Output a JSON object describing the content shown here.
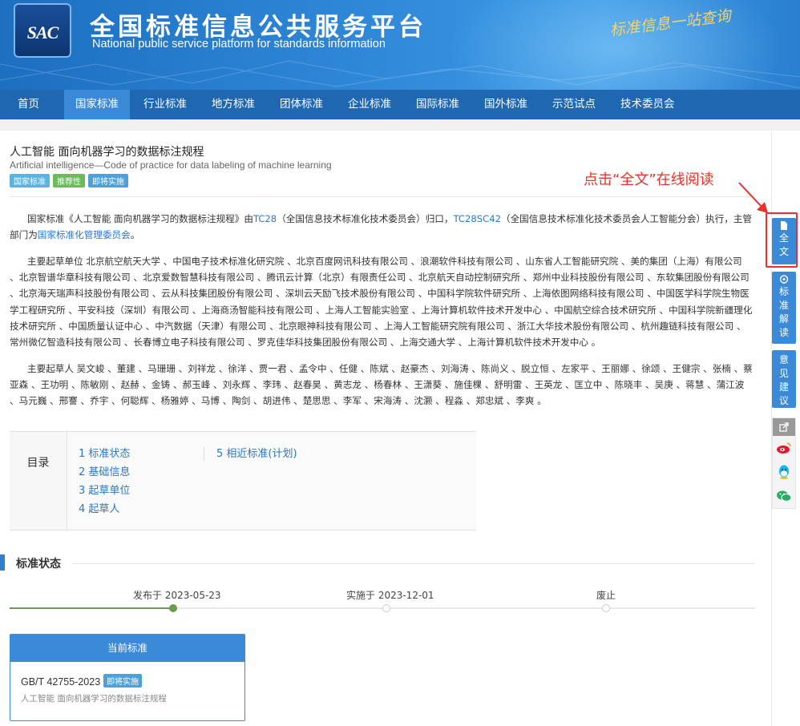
{
  "header": {
    "logo_text": "SAC",
    "site_title": "全国标准信息公共服务平台",
    "site_subtitle": "National public service platform  for standards information",
    "slogan": "标准信息一站查询"
  },
  "nav": {
    "items": [
      "首页",
      "国家标准",
      "行业标准",
      "地方标准",
      "团体标准",
      "企业标准",
      "国际标准",
      "国外标准",
      "示范试点",
      "技术委员会"
    ],
    "active": "国家标准"
  },
  "document": {
    "title": "人工智能 面向机器学习的数据标注规程",
    "subtitle": "Artificial intelligence—Code of practice for data labeling of machine learning",
    "tags": [
      "国家标准",
      "推荐性",
      "即将实施"
    ]
  },
  "intro": {
    "p1": "国家标准《人工智能 面向机器学习的数据标注规程》由",
    "tc": "TC28",
    "p2": "（全国信息技术标准化技术委员会）归口，",
    "sc": "TC28SC42",
    "p3": "（全国信息技术标准化技术委员会人工智能分会）执行，主管部门为",
    "dept": "国家标准化管理委员会",
    "p4": "。"
  },
  "drafting_units": "主要起草单位 北京航空航天大学 、中国电子技术标准化研究院 、北京百度网讯科技有限公司 、浪潮软件科技有限公司 、山东省人工智能研究院 、美的集团（上海）有限公司 、北京智谱华章科技有限公司 、北京爱数智慧科技有限公司 、腾讯云计算（北京）有限责任公司 、北京航天自动控制研究所 、郑州中业科技股份有限公司 、东软集团股份有限公司 、北京海天瑞声科技股份有限公司 、云从科技集团股份有限公司 、深圳云天励飞技术股份有限公司 、中国科学院软件研究所 、上海依图网络科技有限公司 、中国医学科学院生物医学工程研究所 、平安科技（深圳）有限公司 、上海商汤智能科技有限公司 、上海人工智能实验室 、上海计算机软件技术开发中心 、中国航空综合技术研究所 、中国科学院新疆理化技术研究所 、中国质量认证中心 、中汽数据（天津）有限公司 、北京眼神科技有限公司 、上海人工智能研究院有限公司 、浙江大华技术股份有限公司 、杭州趣链科技有限公司 、常州微亿智造科技有限公司 、长春博立电子科技有限公司 、罗克佳华科技集团股份有限公司 、上海交通大学 、上海计算机软件技术开发中心 。",
  "drafters": "主要起草人 吴文峻 、董建 、马珊珊 、刘祥龙 、徐洋 、贾一君 、孟令中 、任健 、陈斌 、赵豪杰 、刘海涛 、陈尚义 、脱立恒 、左家平 、王丽娜 、徐颂 、王健宗 、张楠 、蔡亚森 、王功明 、陈敏刚 、赵赫 、金铸 、郝玉峰 、刘永辉 、李玮 、赵春昊 、黄志龙 、杨春林 、王潇葵 、施佳棵 、舒明雷 、王英龙 、匡立中 、陈晓丰 、吴庚 、蒋慧 、蒲江波 、马元巍 、邢謇 、乔宇 、何聪辉 、杨雅婷 、马博 、陶剑 、胡进伟 、楚思思 、李军 、宋海涛 、沈灏 、程淼 、郑忠斌 、李爽 。",
  "toc": {
    "label": "目录",
    "col1": [
      "1 标准状态",
      "2 基础信息",
      "3 起草单位",
      "4 起草人"
    ],
    "col2": [
      "5 相近标准(计划)"
    ]
  },
  "status": {
    "title": "标准状态",
    "timeline": [
      {
        "label": "发布于 2023-05-23",
        "done": true
      },
      {
        "label": "实施于 2023-12-01",
        "done": false
      },
      {
        "label": "废止",
        "done": false
      }
    ],
    "card": {
      "header": "当前标准",
      "code": "GB/T 42755-2023",
      "badge": "即将实施",
      "name": "人工智能 面向机器学习的数据标注规程"
    }
  },
  "annotation": "点击“全文”在线阅读",
  "sidebar": {
    "full_text": "全文",
    "interpretation": "标准解读",
    "feedback": "意见建议",
    "share_icons": [
      "share-icon",
      "weibo-icon",
      "qq-icon",
      "wechat-icon"
    ]
  },
  "colors": {
    "primary": "#3b8ad8",
    "nav": "#1f67b1",
    "annotation": "#e8312a",
    "link": "#2a78c8"
  }
}
